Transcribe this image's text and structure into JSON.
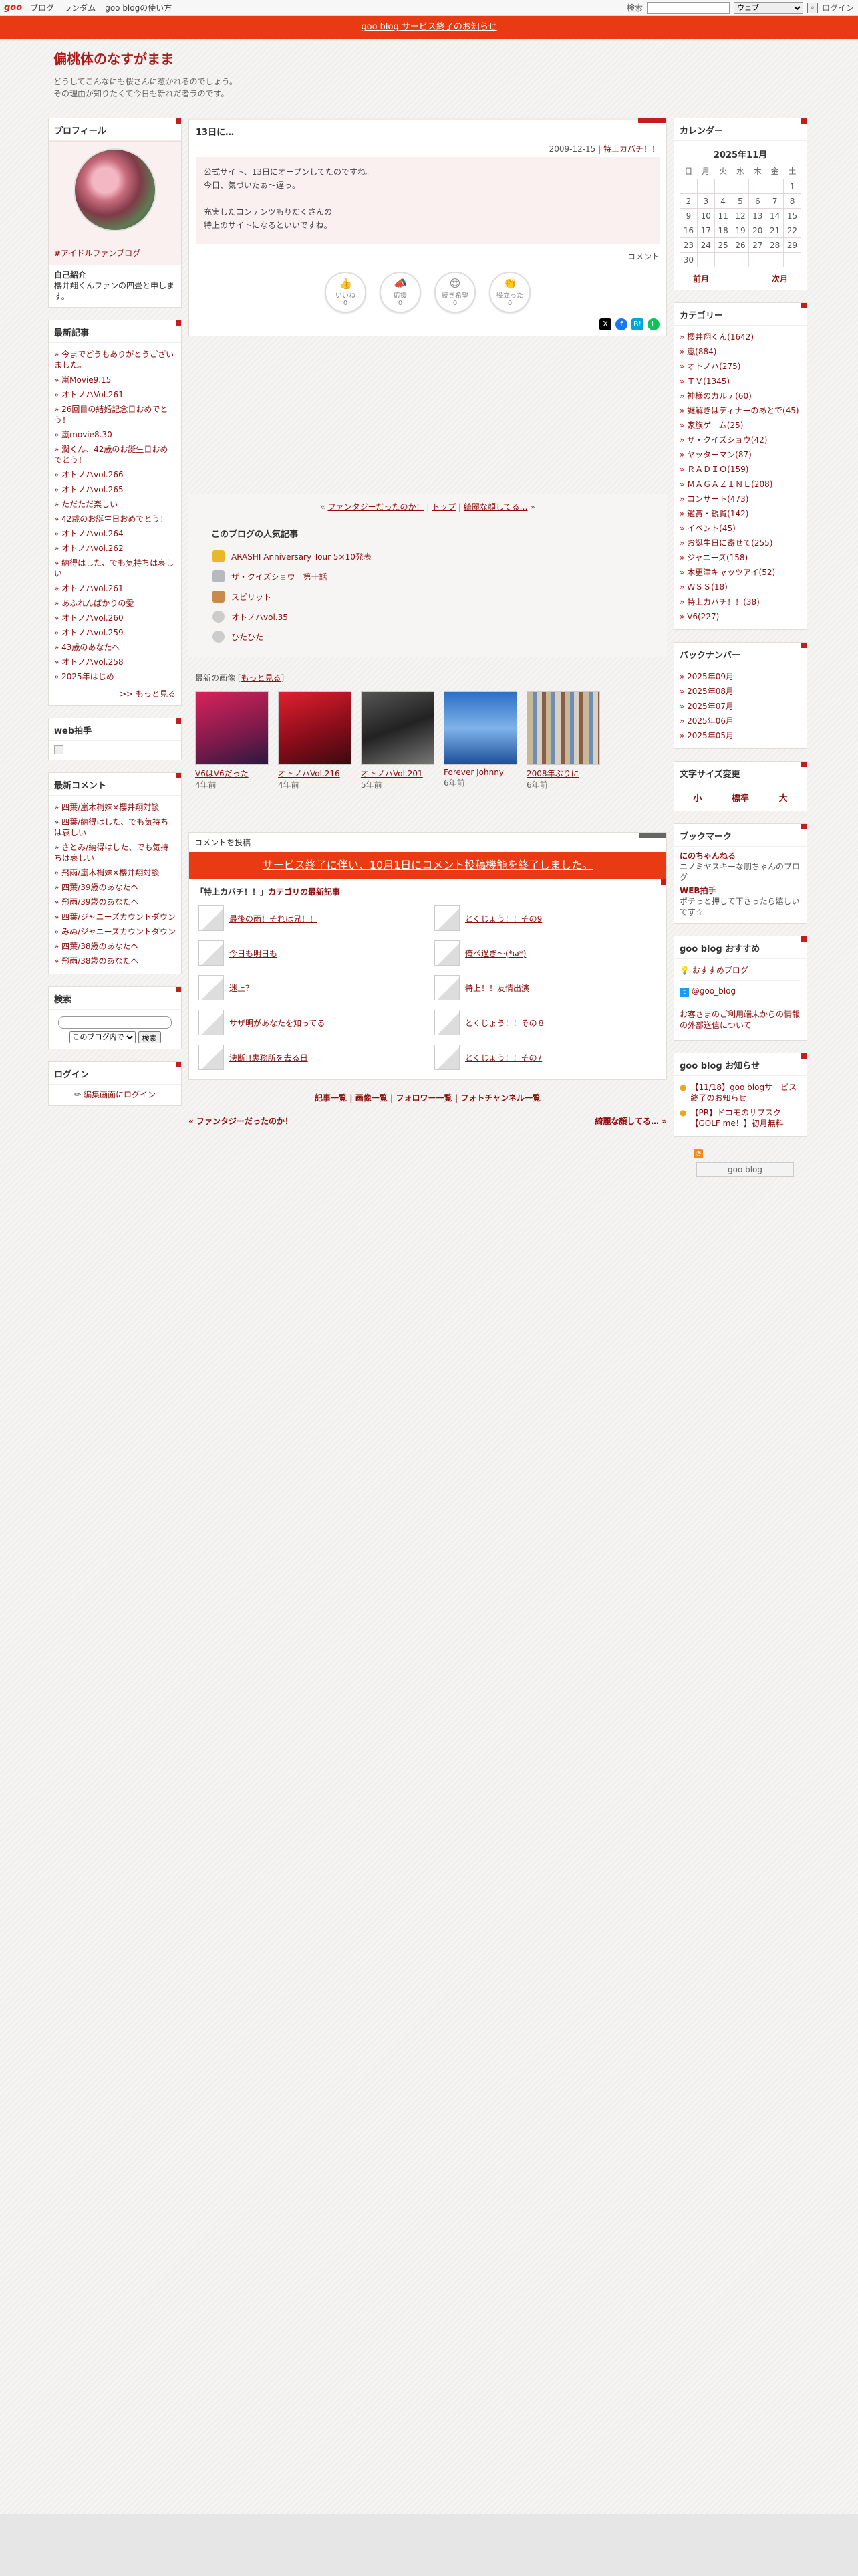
{
  "topbar": {
    "logo": "goo",
    "links": [
      "ブログ",
      "ランダム",
      "goo blogの使い方"
    ],
    "search_label": "検索",
    "search_scope": "ウェブ",
    "login": "ログイン"
  },
  "notice": "goo blog サービス終了のお知らせ",
  "blog": {
    "title": "偏桃体のなすがまま",
    "desc1": "どうしてこんなにも桜さんに惹かれるのでしょう。",
    "desc2": "その理由が知りたくて今日も新れだ者ラのです。"
  },
  "left": {
    "profile": {
      "title": "プロフィール",
      "tag": "#アイドルファンブログ",
      "intro_label": "自己紹介",
      "intro": "櫻井翔くんファンの四畳と申します。"
    },
    "recent": {
      "title": "最新記事",
      "items": [
        "今までどうもありがとうございました。",
        "嵐Movie9.15",
        "オトノハVol.261",
        "26回目の結婚記念日おめでとう！",
        "嵐movie8.30",
        "潤くん、42歳のお誕生日おめでとう！",
        "オトノハvol.266",
        "オトノハvol.265",
        "ただただ楽しい",
        "42歳のお誕生日おめでとう！",
        "オトノハvol.264",
        "オトノハvol.262",
        "納得はした、でも気持ちは哀しい",
        "オトノハvol.261",
        "あふれんばかりの愛",
        "オトノハvol.260",
        "オトノハvol.259",
        "43歳のあなたへ",
        "オトノハvol.258",
        "2025年はじめ"
      ],
      "more": ">> もっと見る"
    },
    "webclap": {
      "title": "web拍手"
    },
    "comments": {
      "title": "最新コメント",
      "items": [
        "四葉/嵐木梢妹×櫻井翔対談",
        "四葉/納得はした、でも気持ちは哀しい",
        "さとみ/納得はした、でも気持ちは哀しい",
        "飛雨/嵐木梢妹×櫻井翔対談",
        "四葉/39歳のあなたへ",
        "飛雨/39歳のあなたへ",
        "四葉/ジャニーズカウントダウン",
        "みぬ/ジャニーズカウントダウン",
        "四葉/38歳のあなたへ",
        "飛雨/38歳のあなたへ"
      ]
    },
    "search": {
      "title": "検索",
      "scope": "このブログ内で",
      "button": "検索"
    },
    "login": {
      "title": "ログイン",
      "link": "編集画面にログイン"
    }
  },
  "main": {
    "entry": {
      "title": "13日に…",
      "date": "2009-12-15",
      "category": "特上カバチ！！",
      "body": [
        "公式サイト、13日にオープンしてたのですね。",
        "今日、気づいたぁ～遅っ。",
        "",
        "充実したコンテンツもりだくさんの",
        "特上のサイトになるといいですね。"
      ],
      "comment_label": "コメント",
      "reactions": [
        {
          "label": "いいね",
          "count": "0",
          "emoji": "👍"
        },
        {
          "label": "応援",
          "count": "0",
          "emoji": "📣"
        },
        {
          "label": "続き希望",
          "count": "0",
          "emoji": "😍"
        },
        {
          "label": "役立った",
          "count": "0",
          "emoji": "👏"
        }
      ],
      "share_icons": [
        "x-icon",
        "facebook-icon",
        "hatena-icon",
        "line-icon"
      ]
    },
    "nav": {
      "prev": "ファンタジーだったのか！",
      "top": "トップ",
      "next": "綺麗な顔してる…"
    },
    "popular": {
      "title": "このブログの人気記事",
      "items": [
        "ARASHI Anniversary Tour 5×10発表",
        "ザ・クイズショウ　第十話",
        "スピリット",
        "オトノハvol.35",
        "ひたひた"
      ]
    },
    "images": {
      "title": "最新の画像",
      "more": "もっと見る",
      "items": [
        {
          "cap": "V6はV6だった",
          "ago": "4年前"
        },
        {
          "cap": "オトノハVol.216",
          "ago": "4年前"
        },
        {
          "cap": "オトノハVol.201",
          "ago": "5年前"
        },
        {
          "cap": "Forever Johnny",
          "ago": "6年前"
        },
        {
          "cap": "2008年ぶりに",
          "ago": "6年前"
        }
      ]
    },
    "comment_post": {
      "title": "コメントを投稿",
      "notice": "サービス終了に伴い、10月1日にコメント投稿機能を終了しました。"
    },
    "category_latest": {
      "title_cat": "「特上カバチ！！」",
      "title_rest": "カテゴリの最新記事",
      "items": [
        "最後の雨！それは兄！！",
        "とくじょう！！その9",
        "今日も明日も",
        "俺ぺ過ぎ～(*ω*)",
        "迷上？",
        "特上！！友情出演",
        "サザ明があなたを知ってる",
        "とくじょう！！その８",
        "決断!!裏務所を去る日",
        "とくじょう！！その7"
      ]
    },
    "footer_links": [
      "記事一覧",
      "画像一覧",
      "フォロワー一覧",
      "フォトチャンネル一覧"
    ],
    "pager": {
      "prev": "ファンタジーだったのか！",
      "next": "綺麗な顔してる…"
    }
  },
  "right": {
    "calendar": {
      "title": "カレンダー",
      "month": "2025年11月",
      "weekdays": [
        "日",
        "月",
        "火",
        "水",
        "木",
        "金",
        "土"
      ],
      "weeks": [
        [
          "",
          "",
          "",
          "",
          "",
          "",
          "1"
        ],
        [
          "2",
          "3",
          "4",
          "5",
          "6",
          "7",
          "8"
        ],
        [
          "9",
          "10",
          "11",
          "12",
          "13",
          "14",
          "15"
        ],
        [
          "16",
          "17",
          "18",
          "19",
          "20",
          "21",
          "22"
        ],
        [
          "23",
          "24",
          "25",
          "26",
          "27",
          "28",
          "29"
        ],
        [
          "30",
          "",
          "",
          "",
          "",
          "",
          ""
        ]
      ],
      "prev": "前月",
      "next": "次月"
    },
    "categories": {
      "title": "カテゴリー",
      "items": [
        "櫻井翔くん(1642)",
        "嵐(884)",
        "オトノハ(275)",
        "ＴＶ(1345)",
        "神様のカルテ(60)",
        "謎解きはディナーのあとで(45)",
        "家族ゲーム(25)",
        "ザ・クイズショウ(42)",
        "ヤッターマン(87)",
        "ＲＡＤＩＯ(159)",
        "ＭＡＧＡＺＩＮＥ(208)",
        "コンサート(473)",
        "鑑賞・観覧(142)",
        "イベント(45)",
        "お誕生日に寄せて(255)",
        "ジャニーズ(158)",
        "木更津キャッツアイ(52)",
        "ＷＳＳ(18)",
        "特上カバチ！！(38)",
        "V6(227)"
      ]
    },
    "backnumber": {
      "title": "バックナンバー",
      "items": [
        "2025年09月",
        "2025年08月",
        "2025年07月",
        "2025年06月",
        "2025年05月"
      ]
    },
    "fontsize": {
      "title": "文字サイズ変更",
      "buttons": [
        "小",
        "標準",
        "大"
      ]
    },
    "bookmarks": {
      "title": "ブックマーク",
      "items": [
        {
          "name": "にのちゃんねる",
          "desc": "ニノミヤスキーな朋ちゃんのブログ"
        },
        {
          "name": "WEB拍手",
          "desc": "ポチっと押して下さったら嬉しいです☆"
        }
      ]
    },
    "recommend": {
      "title": "goo blog おすすめ",
      "link1": "おすすめブログ",
      "link2": "@goo_blog",
      "link3": "お客さまのご利用端末からの情報の外部送信について"
    },
    "info": {
      "title": "goo blog お知らせ",
      "items": [
        "【11/18】goo blogサービス終了のお知らせ",
        "【PR】ドコモのサブスク【GOLF me！】初月無料"
      ]
    },
    "badge": "goo blog"
  },
  "colors": {
    "accent": "#c41d1d",
    "notice_bg": "#e83a13",
    "link": "#8b0d0d"
  }
}
